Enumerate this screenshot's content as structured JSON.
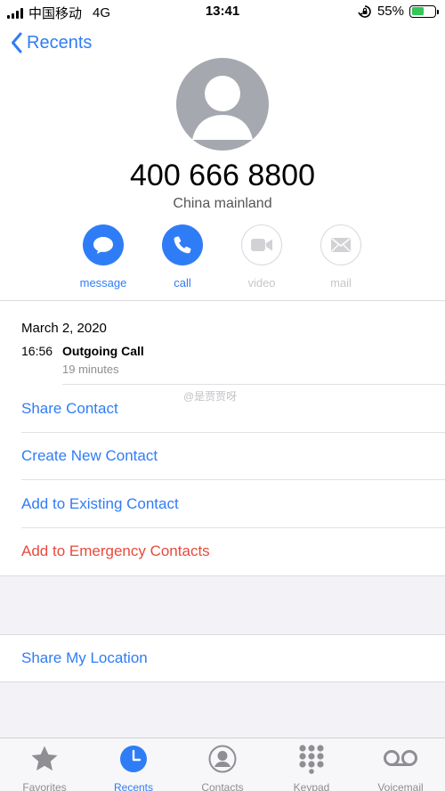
{
  "status_bar": {
    "carrier": "中国移动",
    "network": "4G",
    "time": "13:41",
    "battery": "55%",
    "battery_level": 0.55
  },
  "nav": {
    "back_label": "Recents"
  },
  "contact": {
    "number": "400 666 8800",
    "region": "China mainland"
  },
  "actions": [
    {
      "label": "message",
      "icon": "message-icon",
      "enabled": true
    },
    {
      "label": "call",
      "icon": "phone-icon",
      "enabled": true
    },
    {
      "label": "video",
      "icon": "video-icon",
      "enabled": false
    },
    {
      "label": "mail",
      "icon": "mail-icon",
      "enabled": false
    }
  ],
  "call_log": {
    "date": "March 2, 2020",
    "time": "16:56",
    "type": "Outgoing Call",
    "duration": "19 minutes"
  },
  "watermark": "@是贾贾呀",
  "options": [
    {
      "label": "Share Contact"
    },
    {
      "label": "Create New Contact"
    },
    {
      "label": "Add to Existing Contact"
    },
    {
      "label": "Add to Emergency Contacts"
    }
  ],
  "location_option": "Share My Location",
  "tabs": [
    {
      "label": "Favorites",
      "icon": "star-icon",
      "active": false
    },
    {
      "label": "Recents",
      "icon": "clock-icon",
      "active": true
    },
    {
      "label": "Contacts",
      "icon": "contacts-icon",
      "active": false
    },
    {
      "label": "Keypad",
      "icon": "keypad-icon",
      "active": false
    },
    {
      "label": "Voicemail",
      "icon": "voicemail-icon",
      "active": false
    }
  ],
  "colors": {
    "accent": "#2f7df6",
    "danger": "#e84a3c",
    "disabled": "#c7c7cc",
    "avatar": "#a5a8ae"
  }
}
